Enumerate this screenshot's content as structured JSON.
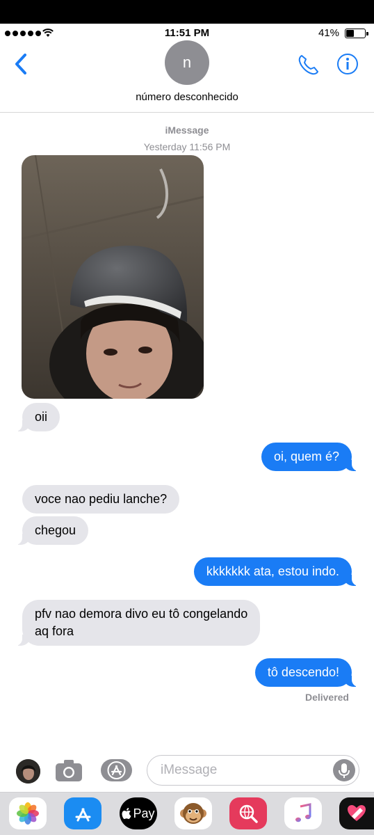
{
  "status_bar": {
    "time": "11:51 PM",
    "battery": "41%"
  },
  "contact": {
    "initial": "n",
    "name": "número desconhecido"
  },
  "thread": {
    "service": "iMessage",
    "date": "Yesterday 11:56 PM"
  },
  "messages": [
    {
      "from": "them",
      "text": "oii"
    },
    {
      "from": "me",
      "text": "oi, quem é?"
    },
    {
      "from": "them",
      "text": "voce nao pediu lanche?"
    },
    {
      "from": "them",
      "text": "chegou"
    },
    {
      "from": "me",
      "text": "kkkkkkk ata, estou indo."
    },
    {
      "from": "them",
      "text": "pfv nao demora divo eu tô congelando"
    },
    {
      "from": "them",
      "text": "aq fora"
    },
    {
      "from": "me",
      "text": "tô descendo!"
    }
  ],
  "delivered": "Delivered",
  "composer": {
    "placeholder": "iMessage"
  },
  "app_drawer": {
    "apple_pay_label": "Pay",
    "icons": [
      "photos-icon",
      "app-store-icon",
      "apple-pay-icon",
      "animoji-monkey-icon",
      "web-search-icon",
      "music-icon",
      "digital-touch-icon"
    ]
  },
  "colors": {
    "accent": "#1a7cf5",
    "incoming": "#e5e5ea",
    "meta": "#8e8e93"
  }
}
